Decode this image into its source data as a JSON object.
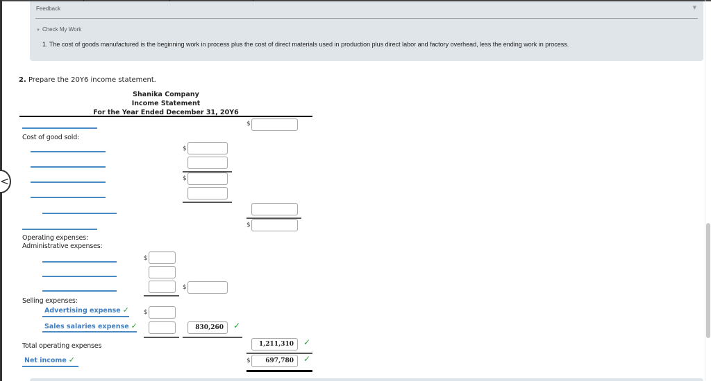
{
  "feedback": {
    "title": "Feedback",
    "collapse_icon": "▼",
    "check_my_work_label": "Check My Work",
    "check_icon": "▼",
    "hint_text": "1. The cost of goods manufactured is the beginning work in process plus the cost of direct materials used in production plus direct labor and factory overhead, less the ending work in process."
  },
  "question": {
    "number": "2.",
    "text": "Prepare the 20Y6 income statement."
  },
  "statement": {
    "company": "Shanika Company",
    "title": "Income Statement",
    "period": "For the Year Ended December 31, 20Y6",
    "labels": {
      "cogs": "Cost of good sold:",
      "operating_expenses": "Operating expenses:",
      "administrative_expenses": "Administrative expenses:",
      "selling_expenses": "Selling expenses:",
      "total_operating_expenses": "Total operating expenses"
    },
    "selected_labels": {
      "advertising_expense": "Advertising expense",
      "sales_salaries_expense": "Sales salaries expense",
      "net_income": "Net income"
    },
    "check_mark": "✓",
    "currency": "$",
    "values": {
      "revenue": "",
      "cogs_1": "",
      "cogs_2": "",
      "cogs_3": "",
      "cogs_4": "",
      "cogs_total": "",
      "gross_profit": "",
      "admin_1": "",
      "admin_2": "",
      "admin_3": "",
      "admin_total": "",
      "advertising": "",
      "sales_salaries": "",
      "selling_total": "830,260",
      "total_operating_expenses": "1,211,310",
      "net_income": "697,780"
    }
  },
  "nav": {
    "back_icon": "<"
  }
}
